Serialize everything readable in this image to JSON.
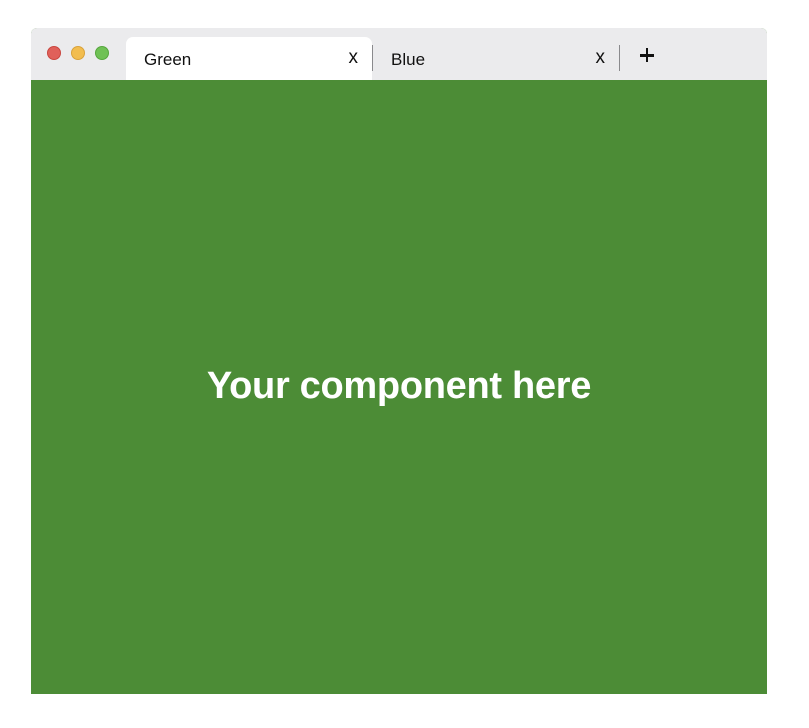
{
  "tabs": [
    {
      "label": "Green",
      "close_label": "x",
      "active": true
    },
    {
      "label": "Blue",
      "close_label": "x",
      "active": false
    }
  ],
  "new_tab_icon": "plus-icon",
  "content": {
    "text": "Your component here",
    "background_color": "#4c8c36",
    "text_color": "#ffffff"
  },
  "traffic_lights": {
    "close_color": "#e0605a",
    "minimize_color": "#f2bd4f",
    "zoom_color": "#6fc155"
  }
}
